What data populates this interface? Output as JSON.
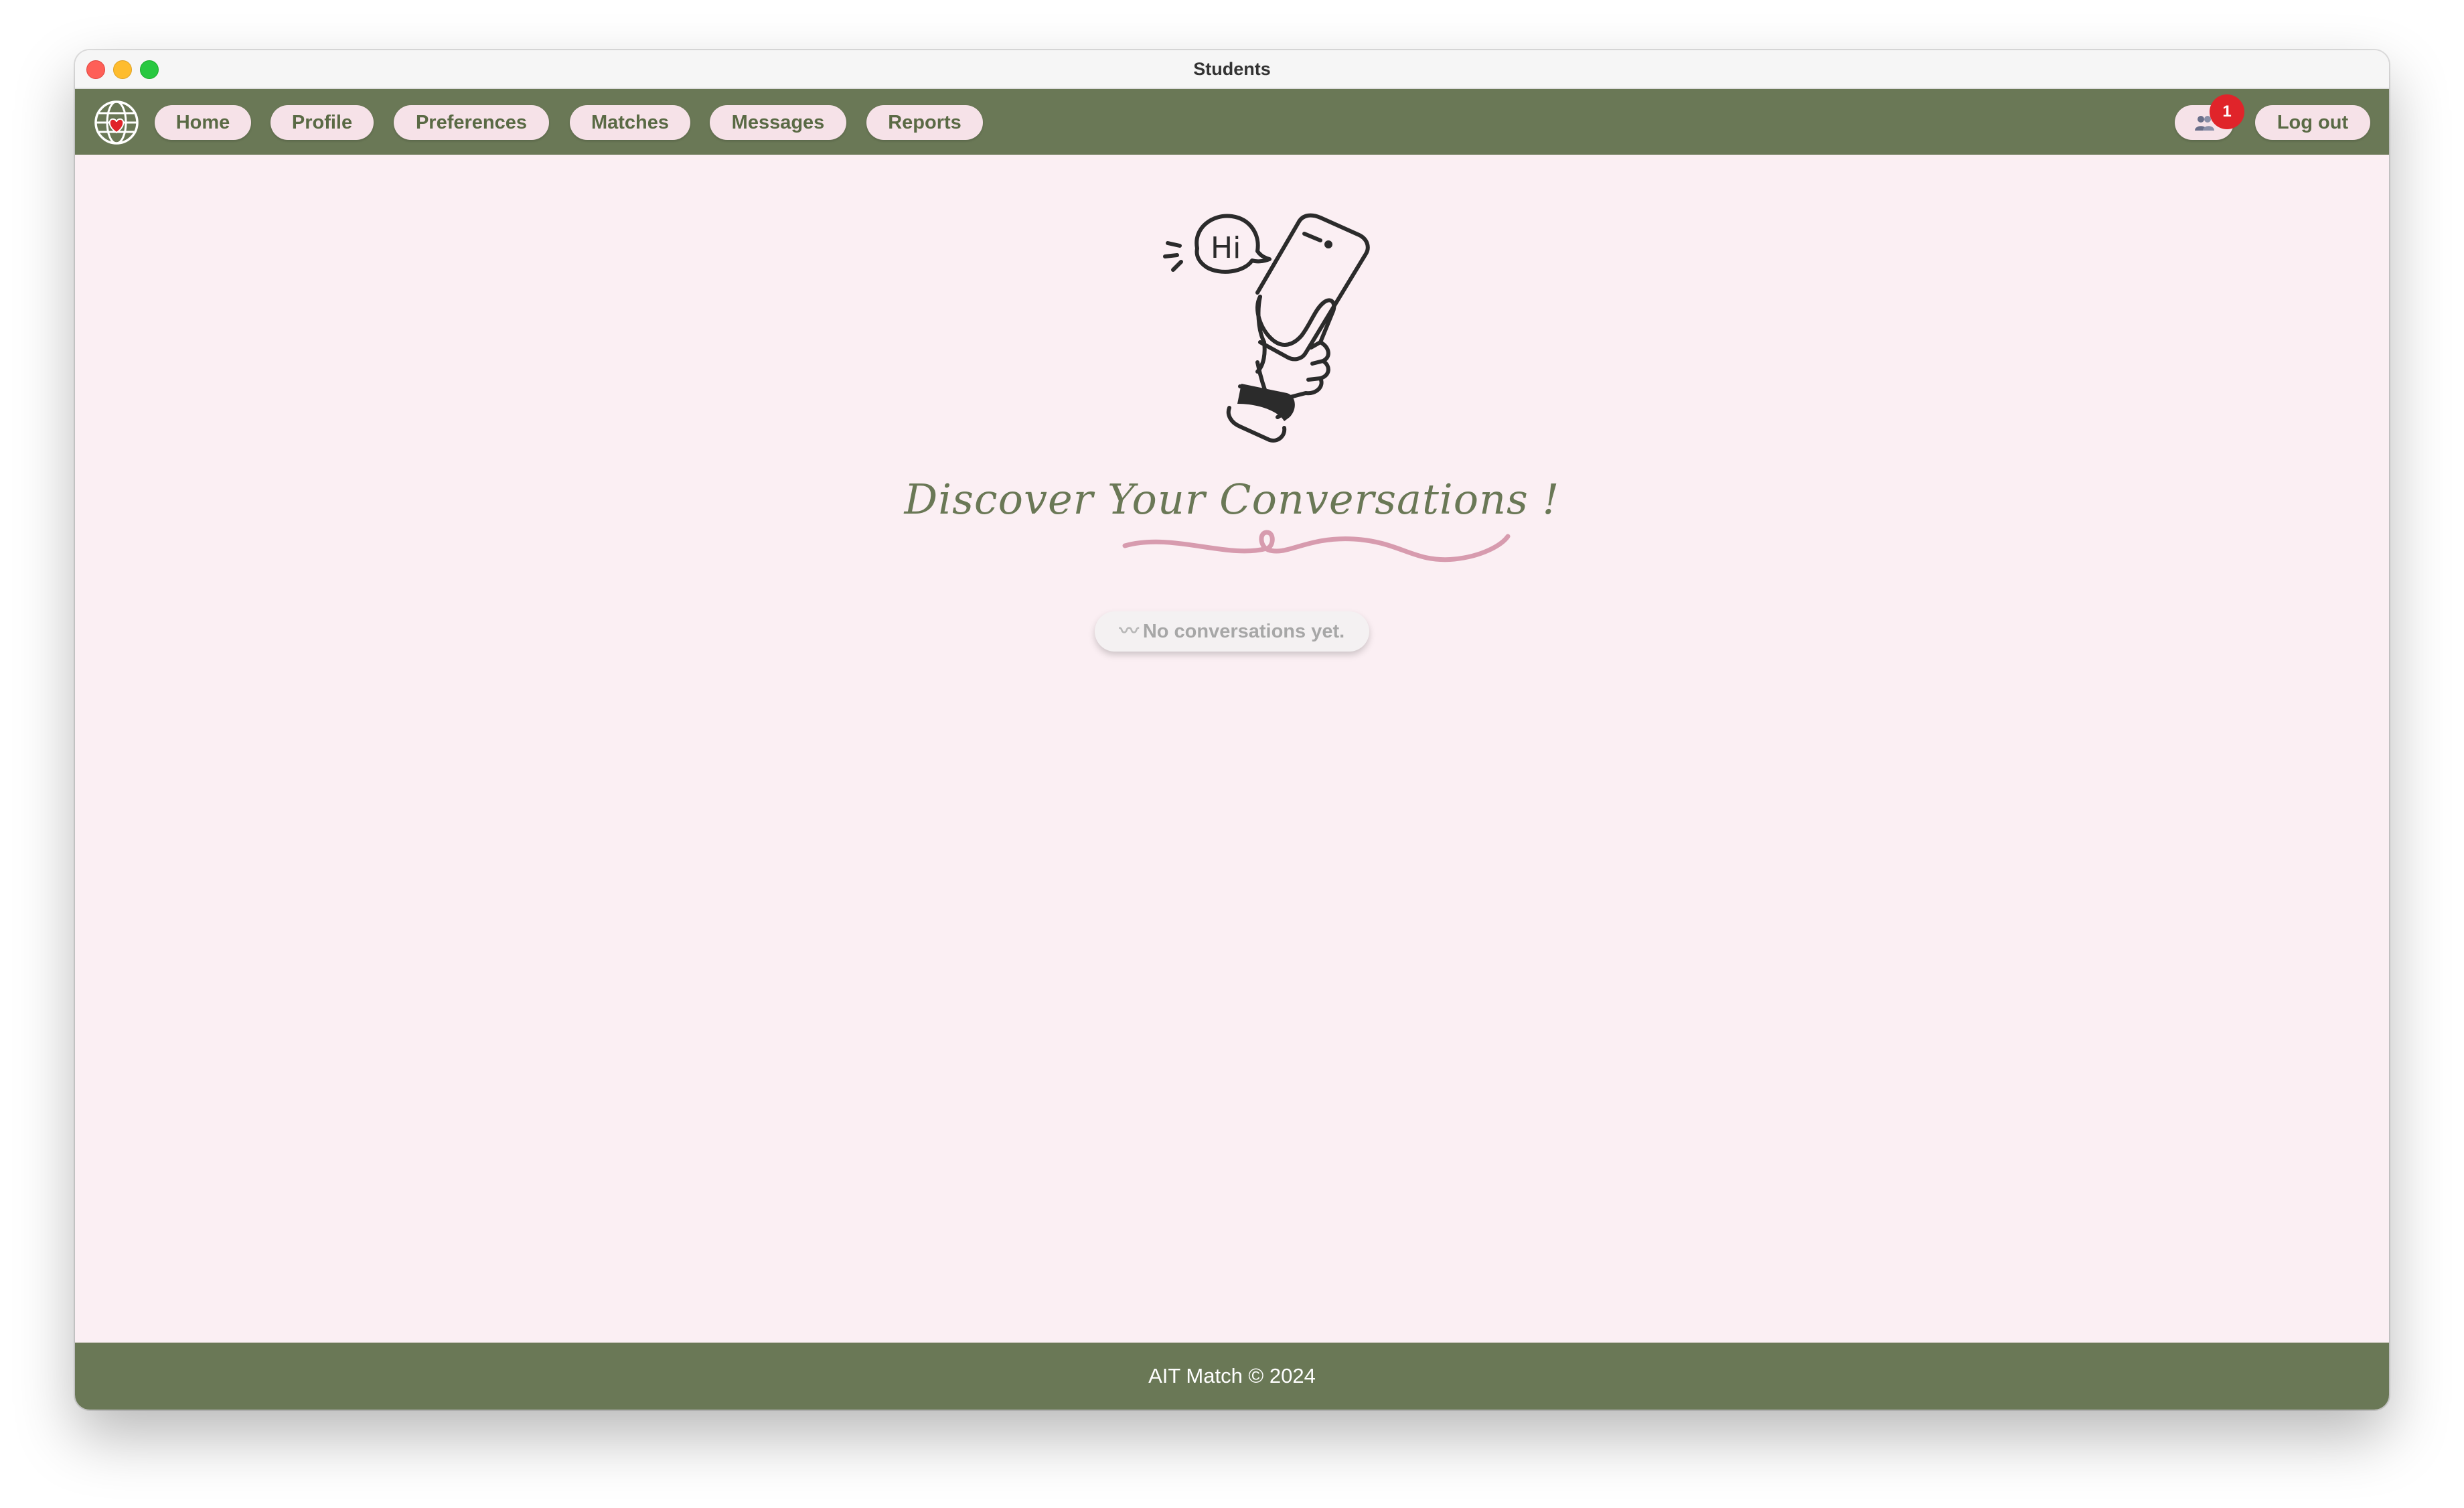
{
  "window": {
    "title": "Students"
  },
  "nav": {
    "logo_icon": "globe-heart-icon",
    "items": [
      {
        "label": "Home"
      },
      {
        "label": "Profile"
      },
      {
        "label": "Preferences"
      },
      {
        "label": "Matches"
      },
      {
        "label": "Messages"
      },
      {
        "label": "Reports"
      }
    ],
    "friends_icon": "people-icon",
    "notification_count": "1",
    "logout_label": "Log out"
  },
  "main": {
    "illustration_text": "Hi",
    "heading": "Discover Your Conversations !",
    "empty_icon": "〰",
    "empty_text": "No conversations yet."
  },
  "footer": {
    "text": "AIT Match © 2024"
  },
  "colors": {
    "accent": "#6a7856",
    "background": "#fbeff3",
    "pill": "#f6e2e8",
    "badge": "#e0242a",
    "squiggle": "#d79bae"
  }
}
